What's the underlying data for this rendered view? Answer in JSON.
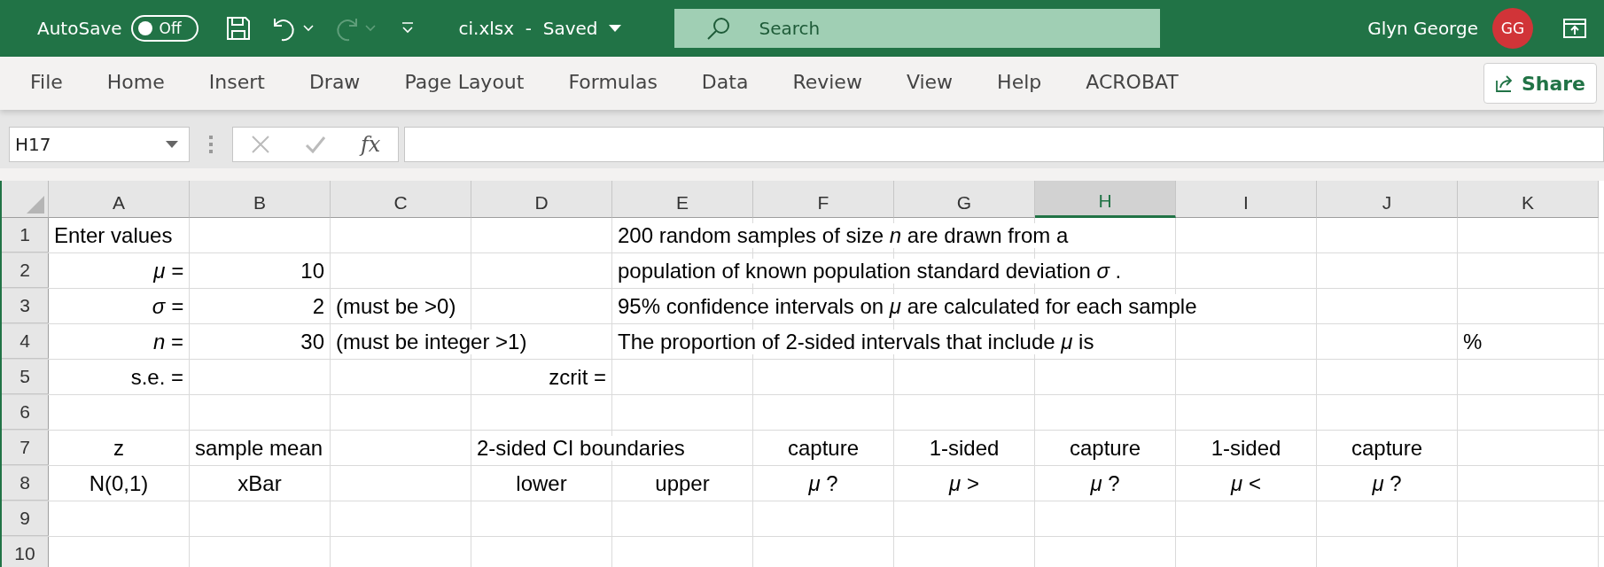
{
  "title_bar": {
    "autosave_label": "AutoSave",
    "autosave_toggle": {
      "label": "Off",
      "on": false
    },
    "redo_disabled": true,
    "document_title": "ci.xlsx  -  Saved",
    "search": {
      "placeholder": "Search"
    },
    "user_name": "Glyn George",
    "avatar_initials": "GG"
  },
  "ribbon_tabs": [
    {
      "label": "File",
      "selected": false
    },
    {
      "label": "Home",
      "selected": false
    },
    {
      "label": "Insert",
      "selected": false
    },
    {
      "label": "Draw",
      "selected": false
    },
    {
      "label": "Page Layout",
      "selected": false
    },
    {
      "label": "Formulas",
      "selected": false
    },
    {
      "label": "Data",
      "selected": false
    },
    {
      "label": "Review",
      "selected": false
    },
    {
      "label": "View",
      "selected": false
    },
    {
      "label": "Help",
      "selected": false
    },
    {
      "label": "ACROBAT",
      "selected": false
    }
  ],
  "share_button": "Share",
  "formula_bar": {
    "name_box": "H17",
    "fx_label": "fx"
  },
  "columns": [
    {
      "label": "A",
      "selected": false
    },
    {
      "label": "B",
      "selected": false
    },
    {
      "label": "C",
      "selected": false
    },
    {
      "label": "D",
      "selected": false
    },
    {
      "label": "E",
      "selected": false
    },
    {
      "label": "F",
      "selected": false
    },
    {
      "label": "G",
      "selected": false
    },
    {
      "label": "H",
      "selected": true
    },
    {
      "label": "I",
      "selected": false
    },
    {
      "label": "J",
      "selected": false
    },
    {
      "label": "K",
      "selected": false
    }
  ],
  "rows": [
    {
      "number": "1",
      "cells": [
        {
          "text": "Enter values",
          "kind": "note"
        },
        null,
        null,
        null,
        {
          "text": "200 random samples of size *n* are drawn from a",
          "kind": "note"
        },
        null,
        null,
        null,
        null,
        null,
        null
      ]
    },
    {
      "number": "2",
      "cells": [
        {
          "text": "*μ =*",
          "kind": "value"
        },
        {
          "text": "10",
          "kind": "value"
        },
        null,
        null,
        {
          "text": "population of known population standard deviation *σ* .",
          "kind": "note"
        },
        null,
        null,
        null,
        null,
        null,
        null
      ]
    },
    {
      "number": "3",
      "cells": [
        {
          "text": "*σ =*",
          "kind": "value"
        },
        {
          "text": "2",
          "kind": "value"
        },
        {
          "text": "(must be >0)",
          "kind": "note"
        },
        null,
        {
          "text": "95% confidence intervals on *μ* are calculated for each sample",
          "kind": "note"
        },
        null,
        null,
        null,
        null,
        null,
        null
      ]
    },
    {
      "number": "4",
      "cells": [
        {
          "text": "*n* =",
          "kind": "value"
        },
        {
          "text": "30",
          "kind": "value"
        },
        {
          "text": "(must be integer >1)",
          "kind": "note"
        },
        null,
        {
          "text": "The proportion of 2-sided intervals that include *μ* is",
          "kind": "note"
        },
        null,
        null,
        null,
        null,
        null,
        {
          "text": "%",
          "kind": "note"
        }
      ]
    },
    {
      "number": "5",
      "cells": [
        {
          "text": "s.e. =",
          "kind": "value"
        },
        null,
        null,
        {
          "text": "zcrit =",
          "kind": "value"
        },
        null,
        null,
        null,
        null,
        null,
        null,
        null
      ]
    },
    {
      "number": "6",
      "cells": [
        null,
        null,
        null,
        null,
        null,
        null,
        null,
        null,
        null,
        null,
        null
      ]
    },
    {
      "number": "7",
      "cells": [
        {
          "text": "z",
          "kind": "heading"
        },
        {
          "text": "sample mean",
          "kind": "note"
        },
        null,
        {
          "text": "2-sided CI boundaries",
          "kind": "note"
        },
        null,
        {
          "text": "capture",
          "kind": "heading"
        },
        {
          "text": "1-sided",
          "kind": "heading"
        },
        {
          "text": "capture",
          "kind": "heading"
        },
        {
          "text": "1-sided",
          "kind": "heading"
        },
        {
          "text": "capture",
          "kind": "heading"
        },
        null
      ]
    },
    {
      "number": "8",
      "cells": [
        {
          "text": "N(0,1)",
          "kind": "heading"
        },
        {
          "text": "xBar",
          "kind": "heading"
        },
        null,
        {
          "text": "lower",
          "kind": "heading"
        },
        {
          "text": "upper",
          "kind": "heading"
        },
        {
          "text": "*μ* ?",
          "kind": "heading"
        },
        {
          "text": "*μ* >",
          "kind": "heading"
        },
        {
          "text": "*μ* ?",
          "kind": "heading"
        },
        {
          "text": "*μ* <",
          "kind": "heading"
        },
        {
          "text": "*μ* ?",
          "kind": "heading"
        },
        null
      ]
    },
    {
      "number": "9",
      "cells": [
        null,
        null,
        null,
        null,
        null,
        null,
        null,
        null,
        null,
        null,
        null
      ]
    },
    {
      "number": "10",
      "cells": [
        null,
        null,
        null,
        null,
        null,
        null,
        null,
        null,
        null,
        null,
        null
      ]
    }
  ]
}
